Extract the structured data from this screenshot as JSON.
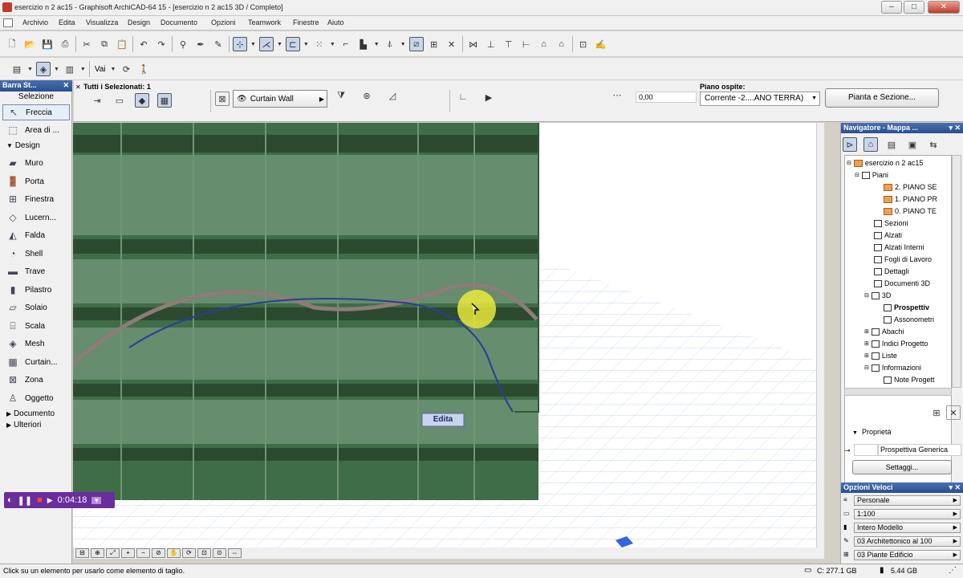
{
  "window": {
    "title": "esercizio n 2 ac15 - Graphisoft ArchiCAD-64 15 - [esercizio n 2 ac15 3D / Completo]",
    "min_icon": "minimize-icon",
    "max_icon": "maximize-icon",
    "close_icon": "close-icon"
  },
  "menu": [
    "Archivio",
    "Edita",
    "Visualizza",
    "Design",
    "Documento",
    "Opzioni",
    "Teamwork",
    "Finestre",
    "Aiuto"
  ],
  "toolbar2": {
    "vai_label": "Vai"
  },
  "toolbox": {
    "title": "Barra St...",
    "selezione_label": "Selezione",
    "freccia_label": "Freccia",
    "area_label": "Area di ...",
    "design_label": "Design",
    "tools": [
      "Muro",
      "Porta",
      "Finestra",
      "Lucern...",
      "Falda",
      "Shell",
      "Trave",
      "Pilastro",
      "Solaio",
      "Scala",
      "Mesh",
      "Curtain...",
      "Zona",
      "Oggetto"
    ],
    "documento_label": "Documento",
    "ulteriori_label": "Ulteriori"
  },
  "infobox": {
    "selected_label": "Tutti i Selezionati: 1",
    "curtain_wall_label": "Curtain Wall",
    "offset_value": "0,00",
    "piano_ospite_label": "Piano ospite:",
    "piano_ospite_value": "Corrente -2....ANO TERRA)",
    "pianta_sezione_button": "Pianta e Sezione..."
  },
  "viewport": {
    "edita_label": "Edita"
  },
  "recorder": {
    "time": "0:04:18"
  },
  "navigator": {
    "title": "Navigatore - Mappa ...",
    "tree": [
      {
        "label": "esercizio n 2 ac15",
        "indent": 0
      },
      {
        "label": "Piani",
        "indent": 1
      },
      {
        "label": "2. PIANO SE",
        "indent": 3
      },
      {
        "label": "1. PIANO PR",
        "indent": 3
      },
      {
        "label": "0. PIANO TE",
        "indent": 3
      },
      {
        "label": "Sezioni",
        "indent": 2
      },
      {
        "label": "Alzati",
        "indent": 2
      },
      {
        "label": "Alzati Interni",
        "indent": 2
      },
      {
        "label": "Fogli di Lavoro",
        "indent": 2
      },
      {
        "label": "Dettagli",
        "indent": 2
      },
      {
        "label": "Documenti 3D",
        "indent": 2
      },
      {
        "label": "3D",
        "indent": 2
      },
      {
        "label": "Prospettiv",
        "indent": 3
      },
      {
        "label": "Assonometri",
        "indent": 3
      },
      {
        "label": "Abachi",
        "indent": 2
      },
      {
        "label": "Indici Progetto",
        "indent": 2
      },
      {
        "label": "Liste",
        "indent": 2
      },
      {
        "label": "Informazioni",
        "indent": 2
      },
      {
        "label": "Note Progett",
        "indent": 3
      }
    ],
    "proprieta_label": "Proprietà",
    "prop_value": "Prospettiva Generica",
    "settaggi_button": "Settaggi..."
  },
  "opzioni": {
    "title": "Opzioni Veloci",
    "rows": [
      "Personale",
      "1:100",
      "Intero Modello",
      "03 Architettonico al 100",
      "03 Piante Edificio"
    ]
  },
  "status": {
    "message": "Click su un elemento per usarlo come elemento di taglio.",
    "disk": "C: 277.1 GB",
    "ram": "5.44 GB"
  }
}
